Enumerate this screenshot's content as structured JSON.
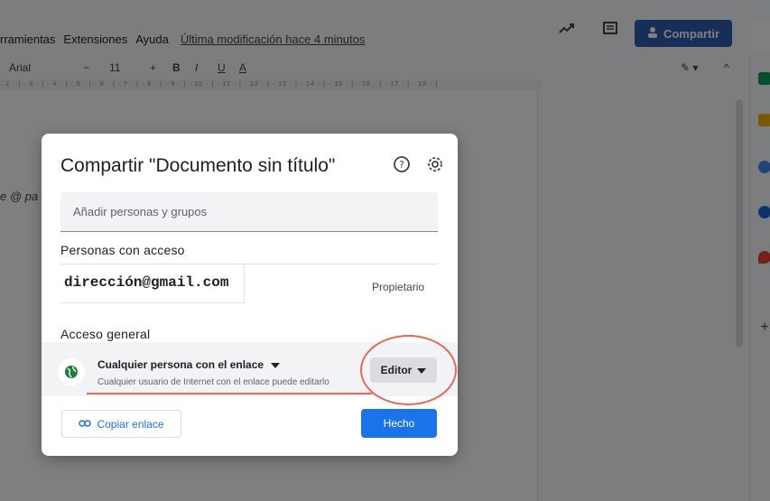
{
  "menu": {
    "items": [
      "rramientas",
      "Extensiones",
      "Ayuda"
    ],
    "last_modified": "Última modificación hace 4 minutos"
  },
  "share": {
    "label": "Compartir"
  },
  "toolbar": {
    "font": "Arial",
    "font_size": "11"
  },
  "ruler": {
    "text": "· 2 · | · 3 · | · 4 · | · 5 · | · 6 · | · 7 · | · 8 · | · 9 · | · 10 · | · 11 · | · 12 · | · 13 · | · 14 · | · 15 · | · 16 · | · 17 · | · 18 · |"
  },
  "doc": {
    "fragment": "e @ pa"
  },
  "dialog": {
    "title": "Compartir \"Documento sin título\"",
    "add_placeholder": "Añadir personas y grupos",
    "people_heading": "Personas con acceso",
    "person_email": "dirección@gmail.com",
    "person_role": "Propietario",
    "general_heading": "Acceso general",
    "link_mode": "Cualquier persona con el enlace",
    "link_description": "Cualquier usuario de Internet con el enlace puede editarlo",
    "role": "Editor",
    "copy_link": "Copiar enlace",
    "done": "Hecho"
  },
  "colors": {
    "accent": "#1a73e8",
    "share_button": "#2f5eb0",
    "annotation": "#e8695a",
    "globe": "#188038"
  },
  "icons": [
    "trending-icon",
    "comment-icon",
    "person-icon",
    "help-icon",
    "gear-icon",
    "globe-icon",
    "dropdown-icon",
    "link-icon"
  ]
}
